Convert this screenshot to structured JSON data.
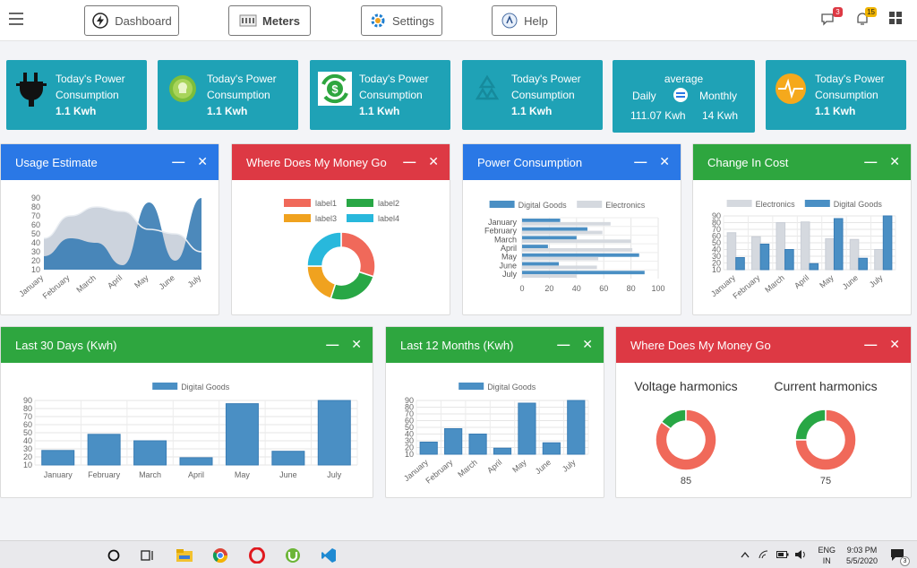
{
  "nav": {
    "dashboard": "Dashboard",
    "meters": "Meters",
    "settings": "Settings",
    "help": "Help",
    "messages_badge": "3",
    "alerts_badge": "15"
  },
  "stats": [
    {
      "title": "Today's Power Consumption",
      "value": "1.1 Kwh",
      "icon": "plug-icon"
    },
    {
      "title": "Today's Power Consumption",
      "value": "1.1 Kwh",
      "icon": "leaf-bulb-icon"
    },
    {
      "title": "Today's Power Consumption",
      "value": "1.1 Kwh",
      "icon": "money-recycle-icon"
    },
    {
      "title": "Today's Power Consumption",
      "value": "1.1 Kwh",
      "icon": "recycle-icon"
    },
    {
      "title": "Today's Power Consumption",
      "value": "1.1 Kwh",
      "icon": "pulse-icon"
    }
  ],
  "average": {
    "title": "average",
    "daily_label": "Daily",
    "monthly_label": "Monthly",
    "daily_value": "111.07 Kwh",
    "monthly_value": "14 Kwh"
  },
  "panels": {
    "usage": "Usage Estimate",
    "money1": "Where Does My Money Go",
    "power": "Power Consumption",
    "cost": "Change In Cost",
    "last30": "Last 30 Days (Kwh)",
    "last12": "Last 12 Months (Kwh)",
    "money2": "Where Does My Money Go"
  },
  "controls": {
    "minimize": "—",
    "close": "✕"
  },
  "colors": {
    "blue": "#2a78e6",
    "red": "#dd3944",
    "green": "#2ea63f",
    "teal": "#1fa2b6",
    "series_blue": "#4a8fc4",
    "series_gray": "#d5d9df"
  },
  "chart_data": [
    {
      "id": "usage",
      "type": "area",
      "categories": [
        "January",
        "February",
        "March",
        "April",
        "May",
        "June",
        "July"
      ],
      "series": [
        {
          "values": [
            45,
            70,
            80,
            75,
            55,
            50,
            30
          ]
        },
        {
          "values": [
            25,
            45,
            40,
            15,
            85,
            20,
            90
          ]
        }
      ],
      "ylim": [
        10,
        90
      ],
      "yticks": [
        10,
        20,
        30,
        40,
        50,
        60,
        70,
        80,
        90
      ]
    },
    {
      "id": "money-donut",
      "type": "pie",
      "legend": [
        "label1",
        "label2",
        "label3",
        "label4"
      ],
      "values": [
        30,
        25,
        20,
        25
      ],
      "colors": [
        "#f0695a",
        "#28a745",
        "#f0a21f",
        "#28b8dc"
      ]
    },
    {
      "id": "power",
      "type": "bar",
      "orientation": "horizontal",
      "categories": [
        "January",
        "February",
        "March",
        "April",
        "May",
        "June",
        "July"
      ],
      "series": [
        {
          "name": "Digital Goods",
          "values": [
            28,
            48,
            40,
            19,
            86,
            27,
            90
          ]
        },
        {
          "name": "Electronics",
          "values": [
            65,
            59,
            80,
            81,
            56,
            55,
            40
          ]
        }
      ],
      "xlim": [
        0,
        100
      ],
      "xticks": [
        0,
        20,
        40,
        60,
        80,
        100
      ]
    },
    {
      "id": "cost",
      "type": "bar",
      "categories": [
        "January",
        "February",
        "March",
        "April",
        "May",
        "June",
        "July"
      ],
      "series": [
        {
          "name": "Electronics",
          "values": [
            65,
            59,
            80,
            81,
            56,
            55,
            40
          ]
        },
        {
          "name": "Digital Goods",
          "values": [
            28,
            48,
            40,
            19,
            86,
            27,
            90
          ]
        }
      ],
      "ylim": [
        10,
        90
      ],
      "yticks": [
        10,
        20,
        30,
        40,
        50,
        60,
        70,
        80,
        90
      ]
    },
    {
      "id": "last30",
      "type": "bar",
      "categories": [
        "January",
        "February",
        "March",
        "April",
        "May",
        "June",
        "July"
      ],
      "series": [
        {
          "name": "Digital Goods",
          "values": [
            28,
            48,
            40,
            19,
            86,
            27,
            90
          ]
        }
      ],
      "ylim": [
        10,
        90
      ],
      "yticks": [
        10,
        20,
        30,
        40,
        50,
        60,
        70,
        80,
        90
      ]
    },
    {
      "id": "last12",
      "type": "bar",
      "categories": [
        "January",
        "February",
        "March",
        "April",
        "May",
        "June",
        "July"
      ],
      "series": [
        {
          "name": "Digital Goods",
          "values": [
            28,
            48,
            40,
            19,
            86,
            27,
            90
          ]
        }
      ],
      "ylim": [
        10,
        90
      ],
      "yticks": [
        10,
        20,
        30,
        40,
        50,
        60,
        70,
        80,
        90
      ]
    },
    {
      "id": "voltage",
      "type": "pie",
      "title": "Voltage harmonics",
      "values": [
        85,
        15
      ],
      "colors": [
        "#f0695a",
        "#28a745"
      ],
      "label": "85"
    },
    {
      "id": "current",
      "type": "pie",
      "title": "Current harmonics",
      "values": [
        75,
        25
      ],
      "colors": [
        "#f0695a",
        "#28a745"
      ],
      "label": "75"
    }
  ],
  "taskbar": {
    "lang1": "ENG",
    "lang2": "IN",
    "time": "9:03 PM",
    "date": "5/5/2020",
    "notif": "3"
  }
}
